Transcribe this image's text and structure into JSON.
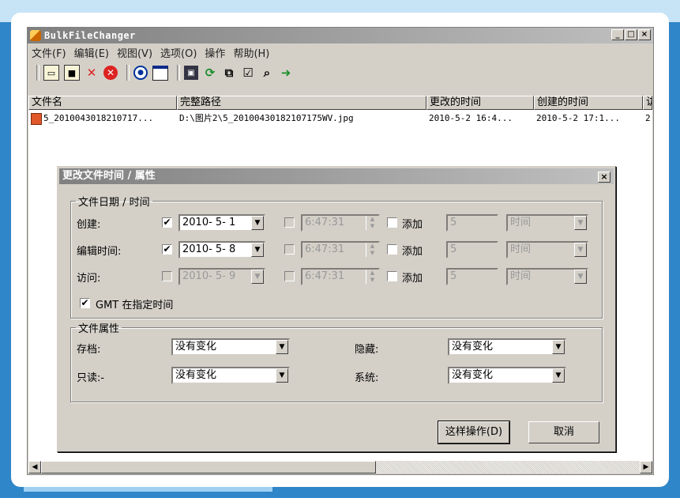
{
  "app": {
    "title": "BulkFileChanger",
    "window_buttons": [
      "_",
      "□",
      "×"
    ]
  },
  "menu": [
    "文件(F)",
    "编辑(E)",
    "视图(V)",
    "选项(O)",
    "操作",
    "帮助(H)"
  ],
  "toolbar": {
    "icons": [
      "open-folder-icon",
      "chip-icon",
      "delete-x-icon",
      "stop-icon",
      "clock-icon",
      "window-icon",
      "save-icon",
      "refresh-icon",
      "copy-icon",
      "properties-icon",
      "search-icon",
      "exit-icon"
    ]
  },
  "list": {
    "columns": [
      "文件名",
      "完整路径",
      "更改的时间",
      "创建的时间",
      "访"
    ],
    "rows": [
      {
        "name": "5_2010043018210717...",
        "path": "D:\\图片2\\5_20100430182107175WV.jpg",
        "modified": "2010-5-2 16:4...",
        "created": "2010-5-2 17:1...",
        "access": "2"
      }
    ]
  },
  "dialog": {
    "title": "更改文件时间 / 属性",
    "close": "×",
    "date_group": "文件日期 / 时间",
    "rows": [
      {
        "label": "创建:",
        "checked": "✔",
        "date": "2010- 5- 1",
        "time_checked": "",
        "time": "6:47:31",
        "add_label": "添加",
        "add_value": "5",
        "unit": "时间"
      },
      {
        "label": "编辑时间:",
        "checked": "✔",
        "date": "2010- 5- 8",
        "time_checked": "",
        "time": "6:47:31",
        "add_label": "添加",
        "add_value": "5",
        "unit": "时间"
      },
      {
        "label": "访问:",
        "checked": "",
        "date": "2010- 5- 9",
        "time_checked": "",
        "time": "6:47:31",
        "add_label": "添加",
        "add_value": "5",
        "unit": "时间"
      }
    ],
    "gmt_check": "✔",
    "gmt_label": "GMT 在指定时间",
    "attr_group": "文件属性",
    "attrs": [
      {
        "label": "存档:",
        "value": "没有变化"
      },
      {
        "label": "隐藏:",
        "value": "没有变化"
      },
      {
        "label": "只读:-",
        "value": "没有变化"
      },
      {
        "label": "系统:",
        "value": "没有变化"
      }
    ],
    "ok_button": "这样操作(D)",
    "cancel_button": "取消"
  }
}
